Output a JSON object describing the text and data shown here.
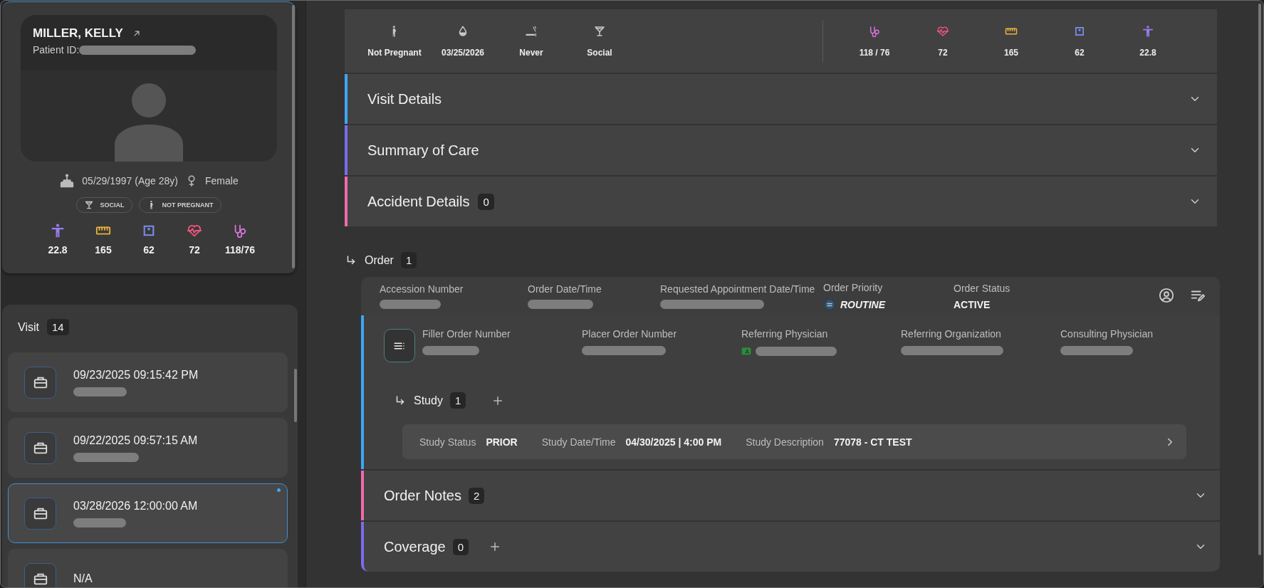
{
  "patient": {
    "name": "MILLER, KELLY",
    "id_label": "Patient ID:",
    "id_redacted": true,
    "birth": "05/29/1997 (Age 28y)",
    "sex": "Female",
    "tags": [
      {
        "kind": "alcohol",
        "label": "SOCIAL"
      },
      {
        "kind": "pregnancy",
        "label": "NOT PREGNANT"
      }
    ],
    "vitals": [
      {
        "kind": "bmi",
        "value": "22.8",
        "color": "#9b7cf2"
      },
      {
        "kind": "height",
        "value": "165",
        "color": "#e9b43c"
      },
      {
        "kind": "weight",
        "value": "62",
        "color": "#7d8cf2"
      },
      {
        "kind": "heart_rate",
        "value": "72",
        "color": "#f0557c"
      },
      {
        "kind": "blood_pressure",
        "value": "118/76",
        "color": "#d573da"
      }
    ]
  },
  "visits": {
    "title": "Visit",
    "count": "14",
    "items": [
      {
        "datetime": "09/23/2025 09:15:42 PM",
        "redacted": true,
        "selected": false
      },
      {
        "datetime": "09/22/2025 09:57:15 AM",
        "redacted": true,
        "selected": false
      },
      {
        "datetime": "03/28/2026 12:00:00 AM",
        "redacted": true,
        "selected": true
      },
      {
        "datetime": "N/A",
        "redacted": false,
        "selected": false
      }
    ]
  },
  "summary_bar": {
    "social": [
      {
        "kind": "pregnancy",
        "value": "Not Pregnant"
      },
      {
        "kind": "lmp",
        "value": "03/25/2026"
      },
      {
        "kind": "smoking",
        "value": "Never"
      },
      {
        "kind": "alcohol",
        "value": "Social"
      }
    ],
    "vitals": [
      {
        "kind": "blood_pressure",
        "value": "118 / 76",
        "color": "#d573da"
      },
      {
        "kind": "heart_rate",
        "value": "72",
        "color": "#f0557c"
      },
      {
        "kind": "height",
        "value": "165",
        "color": "#e9b43c"
      },
      {
        "kind": "weight",
        "value": "62",
        "color": "#7d8cf2"
      },
      {
        "kind": "bmi",
        "value": "22.8",
        "color": "#9b7cf2"
      }
    ]
  },
  "sections": [
    {
      "title": "Visit Details",
      "color": "#3ea6f5"
    },
    {
      "title": "Summary of Care",
      "color": "#7b6cf0"
    },
    {
      "title": "Accident Details",
      "count": "0",
      "color": "#f06ca8"
    }
  ],
  "order": {
    "title": "Order",
    "count": "1",
    "header": [
      {
        "label": "Accession Number",
        "redacted": true
      },
      {
        "label": "Order Date/Time",
        "redacted": true
      },
      {
        "label": "Requested Appointment Date/Time",
        "redacted": true
      },
      {
        "label": "Order Priority",
        "kind": "priority",
        "value": "ROUTINE"
      },
      {
        "label": "Order Status",
        "kind": "status",
        "value": "ACTIVE"
      }
    ],
    "details": [
      {
        "label": "Filler Order Number",
        "redacted": true
      },
      {
        "label": "Placer Order Number",
        "redacted": true
      },
      {
        "label": "Referring Physician",
        "kind": "physician",
        "redacted": true
      },
      {
        "label": "Referring Organization",
        "redacted": true
      },
      {
        "label": "Consulting Physician",
        "redacted": true
      }
    ],
    "study": {
      "title": "Study",
      "count": "1",
      "rows": [
        {
          "status_label": "Study Status",
          "status": "PRIOR",
          "date_label": "Study Date/Time",
          "date": "04/30/2025 | 4:00 PM",
          "desc_label": "Study Description",
          "desc": "77078 - CT TEST"
        }
      ]
    }
  },
  "bottom_sections": [
    {
      "title": "Order Notes",
      "count": "2",
      "color": "#f06ca8",
      "addable": false
    },
    {
      "title": "Coverage",
      "count": "0",
      "color": "#7b6cf0",
      "addable": true
    }
  ]
}
